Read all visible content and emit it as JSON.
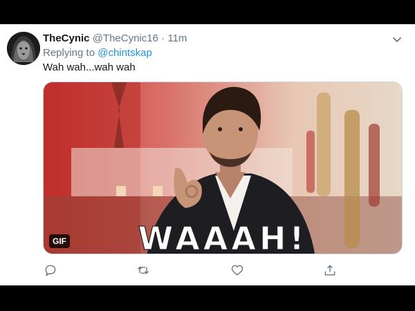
{
  "tweet": {
    "display_name": "TheCynic",
    "handle": "@TheCynic16",
    "separator": "·",
    "time": "11m",
    "reply_prefix": "Replying to ",
    "reply_handle": "@chintskap",
    "text": "Wah wah...wah wah",
    "media": {
      "overlay_text": "WAAAH!",
      "badge": "GIF"
    }
  },
  "icons": {
    "avatar": "lion-avatar",
    "menu": "chevron-down-icon",
    "actions": [
      "reply-icon",
      "retweet-icon",
      "like-icon",
      "share-icon"
    ]
  },
  "colors": {
    "name": "#14171a",
    "muted": "#657786",
    "link": "#1b95e0",
    "frame": "#000000"
  }
}
